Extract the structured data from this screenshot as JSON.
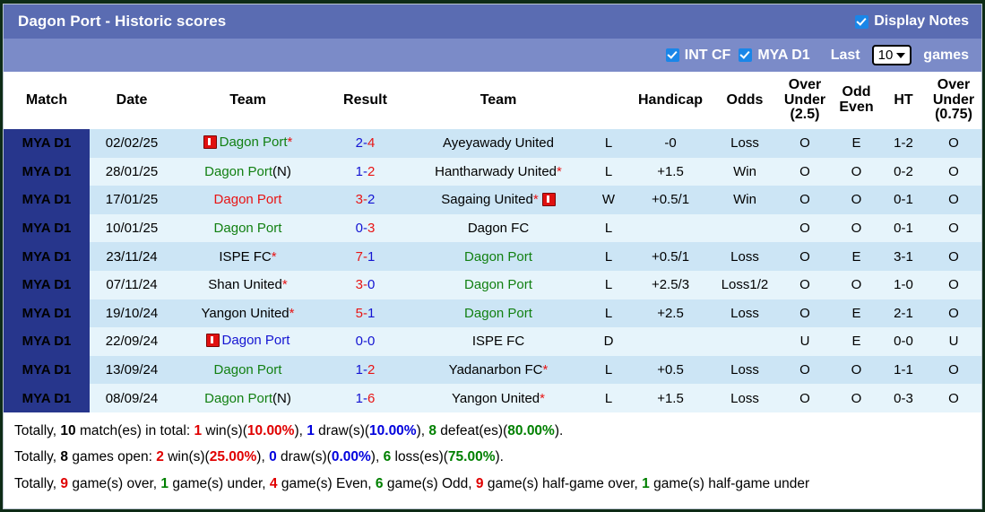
{
  "window": {
    "title": "Dagon Port - Historic scores"
  },
  "header": {
    "display_notes_label": "Display Notes",
    "display_notes_checked": true,
    "filters": [
      {
        "label": "INT CF",
        "checked": true
      },
      {
        "label": "MYA D1",
        "checked": true
      }
    ],
    "last_label": "Last",
    "last_value": "10",
    "games_label": "games"
  },
  "table": {
    "columns": [
      {
        "key": "league",
        "label": "Match"
      },
      {
        "key": "date",
        "label": "Date"
      },
      {
        "key": "team1",
        "label": "Team"
      },
      {
        "key": "result",
        "label": "Result"
      },
      {
        "key": "team2",
        "label": "Team"
      },
      {
        "key": "wdl",
        "label": ""
      },
      {
        "key": "handicap",
        "label": "Handicap"
      },
      {
        "key": "odds",
        "label": "Odds"
      },
      {
        "key": "ou25",
        "label": "Over Under (2.5)"
      },
      {
        "key": "oddeven",
        "label": "Odd Even"
      },
      {
        "key": "ht",
        "label": "HT"
      },
      {
        "key": "ou075",
        "label": "Over Under (0.75)"
      }
    ],
    "column_labels_multiline": {
      "ou25": [
        "Over",
        "Under",
        "(2.5)"
      ],
      "oddeven": [
        "Odd",
        "Even"
      ],
      "ou075": [
        "Over",
        "Under",
        "(0.75)"
      ]
    },
    "rows": [
      {
        "league": "MYA D1",
        "date": "02/02/25",
        "team1": {
          "name": "Dagon Port",
          "color": "green",
          "star": true,
          "suffix": "",
          "note_before": true,
          "note_after": false
        },
        "score_home": "2",
        "score_away": "4",
        "home_color": "blue",
        "away_color": "red",
        "team2": {
          "name": "Ayeyawady United",
          "color": "black",
          "star": false,
          "suffix": "",
          "note_before": false,
          "note_after": false
        },
        "wdl": "L",
        "wdl_color": "green",
        "handicap": "-0",
        "odds": "Loss",
        "odds_color": "green",
        "ou25": "O",
        "ou25_color": "red",
        "oddeven": "E",
        "oddeven_color": "red",
        "ht": "1-2",
        "ou075": "O",
        "ou075_color": "red"
      },
      {
        "league": "MYA D1",
        "date": "28/01/25",
        "team1": {
          "name": "Dagon Port",
          "color": "green",
          "star": false,
          "suffix": "(N)",
          "note_before": false,
          "note_after": false
        },
        "score_home": "1",
        "score_away": "2",
        "home_color": "blue",
        "away_color": "red",
        "team2": {
          "name": "Hantharwady United",
          "color": "black",
          "star": true,
          "suffix": "",
          "note_before": false,
          "note_after": false
        },
        "wdl": "L",
        "wdl_color": "green",
        "handicap": "+1.5",
        "odds": "Win",
        "odds_color": "red",
        "ou25": "O",
        "ou25_color": "red",
        "oddeven": "O",
        "oddeven_color": "green",
        "ht": "0-2",
        "ou075": "O",
        "ou075_color": "red"
      },
      {
        "league": "MYA D1",
        "date": "17/01/25",
        "team1": {
          "name": "Dagon Port",
          "color": "red",
          "star": false,
          "suffix": "",
          "note_before": false,
          "note_after": false
        },
        "score_home": "3",
        "score_away": "2",
        "home_color": "red",
        "away_color": "blue",
        "team2": {
          "name": "Sagaing United",
          "color": "black",
          "star": true,
          "suffix": "",
          "note_before": false,
          "note_after": true
        },
        "wdl": "W",
        "wdl_color": "red",
        "handicap": "+0.5/1",
        "odds": "Win",
        "odds_color": "red",
        "ou25": "O",
        "ou25_color": "red",
        "oddeven": "O",
        "oddeven_color": "green",
        "ht": "0-1",
        "ou075": "O",
        "ou075_color": "red"
      },
      {
        "league": "MYA D1",
        "date": "10/01/25",
        "team1": {
          "name": "Dagon Port",
          "color": "green",
          "star": false,
          "suffix": "",
          "note_before": false,
          "note_after": false
        },
        "score_home": "0",
        "score_away": "3",
        "home_color": "blue",
        "away_color": "red",
        "team2": {
          "name": "Dagon FC",
          "color": "black",
          "star": false,
          "suffix": "",
          "note_before": false,
          "note_after": false
        },
        "wdl": "L",
        "wdl_color": "green",
        "handicap": "",
        "odds": "",
        "odds_color": "green",
        "ou25": "O",
        "ou25_color": "red",
        "oddeven": "O",
        "oddeven_color": "green",
        "ht": "0-1",
        "ou075": "O",
        "ou075_color": "red"
      },
      {
        "league": "MYA D1",
        "date": "23/11/24",
        "team1": {
          "name": "ISPE FC",
          "color": "black",
          "star": true,
          "suffix": "",
          "note_before": false,
          "note_after": false
        },
        "score_home": "7",
        "score_away": "1",
        "home_color": "red",
        "away_color": "blue",
        "team2": {
          "name": "Dagon Port",
          "color": "green",
          "star": false,
          "suffix": "",
          "note_before": false,
          "note_after": false
        },
        "wdl": "L",
        "wdl_color": "green",
        "handicap": "+0.5/1",
        "odds": "Loss",
        "odds_color": "green",
        "ou25": "O",
        "ou25_color": "red",
        "oddeven": "E",
        "oddeven_color": "red",
        "ht": "3-1",
        "ou075": "O",
        "ou075_color": "red"
      },
      {
        "league": "MYA D1",
        "date": "07/11/24",
        "team1": {
          "name": "Shan United",
          "color": "black",
          "star": true,
          "suffix": "",
          "note_before": false,
          "note_after": false
        },
        "score_home": "3",
        "score_away": "0",
        "home_color": "red",
        "away_color": "blue",
        "team2": {
          "name": "Dagon Port",
          "color": "green",
          "star": false,
          "suffix": "",
          "note_before": false,
          "note_after": false
        },
        "wdl": "L",
        "wdl_color": "green",
        "handicap": "+2.5/3",
        "odds": "Loss1/2",
        "odds_color": "green",
        "ou25": "O",
        "ou25_color": "red",
        "oddeven": "O",
        "oddeven_color": "green",
        "ht": "1-0",
        "ou075": "O",
        "ou075_color": "red"
      },
      {
        "league": "MYA D1",
        "date": "19/10/24",
        "team1": {
          "name": "Yangon United",
          "color": "black",
          "star": true,
          "suffix": "",
          "note_before": false,
          "note_after": false
        },
        "score_home": "5",
        "score_away": "1",
        "home_color": "red",
        "away_color": "blue",
        "team2": {
          "name": "Dagon Port",
          "color": "green",
          "star": false,
          "suffix": "",
          "note_before": false,
          "note_after": false
        },
        "wdl": "L",
        "wdl_color": "green",
        "handicap": "+2.5",
        "odds": "Loss",
        "odds_color": "green",
        "ou25": "O",
        "ou25_color": "red",
        "oddeven": "E",
        "oddeven_color": "red",
        "ht": "2-1",
        "ou075": "O",
        "ou075_color": "red"
      },
      {
        "league": "MYA D1",
        "date": "22/09/24",
        "team1": {
          "name": "Dagon Port",
          "color": "blue",
          "star": false,
          "suffix": "",
          "note_before": true,
          "note_after": false
        },
        "score_home": "0",
        "score_away": "0",
        "home_color": "blue",
        "away_color": "blue",
        "team2": {
          "name": "ISPE FC",
          "color": "black",
          "star": false,
          "suffix": "",
          "note_before": false,
          "note_after": false
        },
        "wdl": "D",
        "wdl_color": "blue",
        "handicap": "",
        "odds": "",
        "odds_color": "green",
        "ou25": "U",
        "ou25_color": "green",
        "oddeven": "E",
        "oddeven_color": "red",
        "ht": "0-0",
        "ou075": "U",
        "ou075_color": "green"
      },
      {
        "league": "MYA D1",
        "date": "13/09/24",
        "team1": {
          "name": "Dagon Port",
          "color": "green",
          "star": false,
          "suffix": "",
          "note_before": false,
          "note_after": false
        },
        "score_home": "1",
        "score_away": "2",
        "home_color": "blue",
        "away_color": "red",
        "team2": {
          "name": "Yadanarbon FC",
          "color": "black",
          "star": true,
          "suffix": "",
          "note_before": false,
          "note_after": false
        },
        "wdl": "L",
        "wdl_color": "green",
        "handicap": "+0.5",
        "odds": "Loss",
        "odds_color": "green",
        "ou25": "O",
        "ou25_color": "red",
        "oddeven": "O",
        "oddeven_color": "green",
        "ht": "1-1",
        "ou075": "O",
        "ou075_color": "red"
      },
      {
        "league": "MYA D1",
        "date": "08/09/24",
        "team1": {
          "name": "Dagon Port",
          "color": "green",
          "star": false,
          "suffix": "(N)",
          "note_before": false,
          "note_after": false
        },
        "score_home": "1",
        "score_away": "6",
        "home_color": "blue",
        "away_color": "red",
        "team2": {
          "name": "Yangon United",
          "color": "black",
          "star": true,
          "suffix": "",
          "note_before": false,
          "note_after": false
        },
        "wdl": "L",
        "wdl_color": "green",
        "handicap": "+1.5",
        "odds": "Loss",
        "odds_color": "green",
        "ou25": "O",
        "ou25_color": "red",
        "oddeven": "O",
        "oddeven_color": "green",
        "ht": "0-3",
        "ou075": "O",
        "ou075_color": "red"
      }
    ]
  },
  "summary": {
    "line1": [
      {
        "t": "Totally, ",
        "c": "plain"
      },
      {
        "t": "10",
        "c": "b-black"
      },
      {
        "t": " match(es) in total: ",
        "c": "plain"
      },
      {
        "t": "1",
        "c": "b-red"
      },
      {
        "t": " win(s)(",
        "c": "plain"
      },
      {
        "t": "10.00%",
        "c": "b-red"
      },
      {
        "t": "), ",
        "c": "plain"
      },
      {
        "t": "1",
        "c": "b-blue"
      },
      {
        "t": " draw(s)(",
        "c": "plain"
      },
      {
        "t": "10.00%",
        "c": "b-blue"
      },
      {
        "t": "), ",
        "c": "plain"
      },
      {
        "t": "8",
        "c": "b-green"
      },
      {
        "t": " defeat(es)(",
        "c": "plain"
      },
      {
        "t": "80.00%",
        "c": "b-green"
      },
      {
        "t": ").",
        "c": "plain"
      }
    ],
    "line2": [
      {
        "t": "Totally, ",
        "c": "plain"
      },
      {
        "t": "8",
        "c": "b-black"
      },
      {
        "t": " games open: ",
        "c": "plain"
      },
      {
        "t": "2",
        "c": "b-red"
      },
      {
        "t": " win(s)(",
        "c": "plain"
      },
      {
        "t": "25.00%",
        "c": "b-red"
      },
      {
        "t": "), ",
        "c": "plain"
      },
      {
        "t": "0",
        "c": "b-blue"
      },
      {
        "t": " draw(s)(",
        "c": "plain"
      },
      {
        "t": "0.00%",
        "c": "b-blue"
      },
      {
        "t": "), ",
        "c": "plain"
      },
      {
        "t": "6",
        "c": "b-green"
      },
      {
        "t": " loss(es)(",
        "c": "plain"
      },
      {
        "t": "75.00%",
        "c": "b-green"
      },
      {
        "t": ").",
        "c": "plain"
      }
    ],
    "line3": [
      {
        "t": "Totally, ",
        "c": "plain"
      },
      {
        "t": "9",
        "c": "b-red"
      },
      {
        "t": " game(s) over, ",
        "c": "plain"
      },
      {
        "t": "1",
        "c": "b-green"
      },
      {
        "t": " game(s) under, ",
        "c": "plain"
      },
      {
        "t": "4",
        "c": "b-red"
      },
      {
        "t": " game(s) Even, ",
        "c": "plain"
      },
      {
        "t": "6",
        "c": "b-green"
      },
      {
        "t": " game(s) Odd, ",
        "c": "plain"
      },
      {
        "t": "9",
        "c": "b-red"
      },
      {
        "t": " game(s) half-game over, ",
        "c": "plain"
      },
      {
        "t": "1",
        "c": "b-green"
      },
      {
        "t": " game(s) half-game under",
        "c": "plain"
      }
    ]
  },
  "colors": {
    "title_bar": "#5a6cb2",
    "option_bar": "#7b8bc8",
    "league_badge": "#27368c",
    "row_odd": "#cce5f5",
    "row_even": "#e6f4fb",
    "checkbox": "#1a86e8",
    "green": "#128012",
    "red": "#e81414",
    "blue": "#1414d2"
  }
}
